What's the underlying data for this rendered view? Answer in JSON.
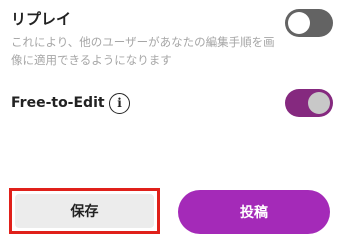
{
  "replay": {
    "title": "リプレイ",
    "description": "これにより、他のユーザーがあなたの編集手順を画像に適用できるようになります",
    "toggle_on": false
  },
  "free_to_edit": {
    "label": "Free-to-Edit",
    "info_glyph": "i",
    "toggle_on": true
  },
  "actions": {
    "save_label": "保存",
    "post_label": "投稿"
  },
  "colors": {
    "toggle_off": "#636363",
    "toggle_on": "#85297f",
    "post_button": "#a42ab8",
    "highlight_border": "#e0201a"
  }
}
